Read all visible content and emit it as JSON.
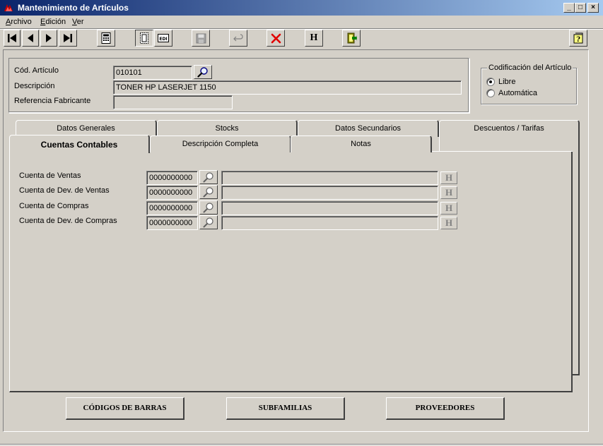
{
  "window": {
    "title": "Mantenimiento de Artículos",
    "controls": {
      "minimize": "_",
      "maximize": "□",
      "close": "×"
    }
  },
  "menu": {
    "items": [
      {
        "label_rest": "rchivo",
        "accel": "A"
      },
      {
        "label_rest": "dición",
        "accel": "E"
      },
      {
        "label_rest": "er",
        "accel": "V"
      }
    ]
  },
  "toolbar": {
    "icons": [
      "first-icon",
      "prev-icon",
      "next-icon",
      "last-icon",
      "calculator-icon",
      "form-view-icon",
      "edit-icon",
      "save-icon",
      "undo-icon",
      "delete-icon",
      "history-icon",
      "exit-icon",
      "help-icon"
    ],
    "history_label": "H"
  },
  "header": {
    "codigo_label": "Cód. Artículo",
    "codigo_value": "010101",
    "descripcion_label": "Descripción",
    "descripcion_value": "TONER HP LASERJET 1150",
    "referencia_label": "Referencia Fabricante",
    "referencia_value": ""
  },
  "codificacion": {
    "title": "Codificación del Artículo",
    "options": [
      {
        "label": "Libre",
        "selected": true
      },
      {
        "label": "Automática",
        "selected": false
      }
    ]
  },
  "tabs": {
    "row_back": [
      "Datos Generales",
      "Stocks",
      "Datos Secundarios",
      "Descuentos / Tarifas"
    ],
    "row_front": [
      "Cuentas Contables",
      "Descripción Completa",
      "Notas"
    ],
    "active": "Cuentas Contables"
  },
  "cuentas": {
    "rows": [
      {
        "label": "Cuenta de Ventas",
        "value": "0000000000",
        "description": "",
        "h": "H"
      },
      {
        "label": "Cuenta de Dev. de Ventas",
        "value": "0000000000",
        "description": "",
        "h": "H"
      },
      {
        "label": "Cuenta de Compras",
        "value": "0000000000",
        "description": "",
        "h": "H"
      },
      {
        "label": "Cuenta de Dev. de Compras",
        "value": "0000000000",
        "description": "",
        "h": "H"
      }
    ]
  },
  "footer": {
    "buttons": [
      "CÓDIGOS DE BARRAS",
      "SUBFAMILIAS",
      "PROVEEDORES"
    ]
  },
  "colors": {
    "face": "#d4d0c8",
    "title_start": "#0a246a",
    "title_end": "#a6caf0",
    "delete_red": "#e00000"
  }
}
